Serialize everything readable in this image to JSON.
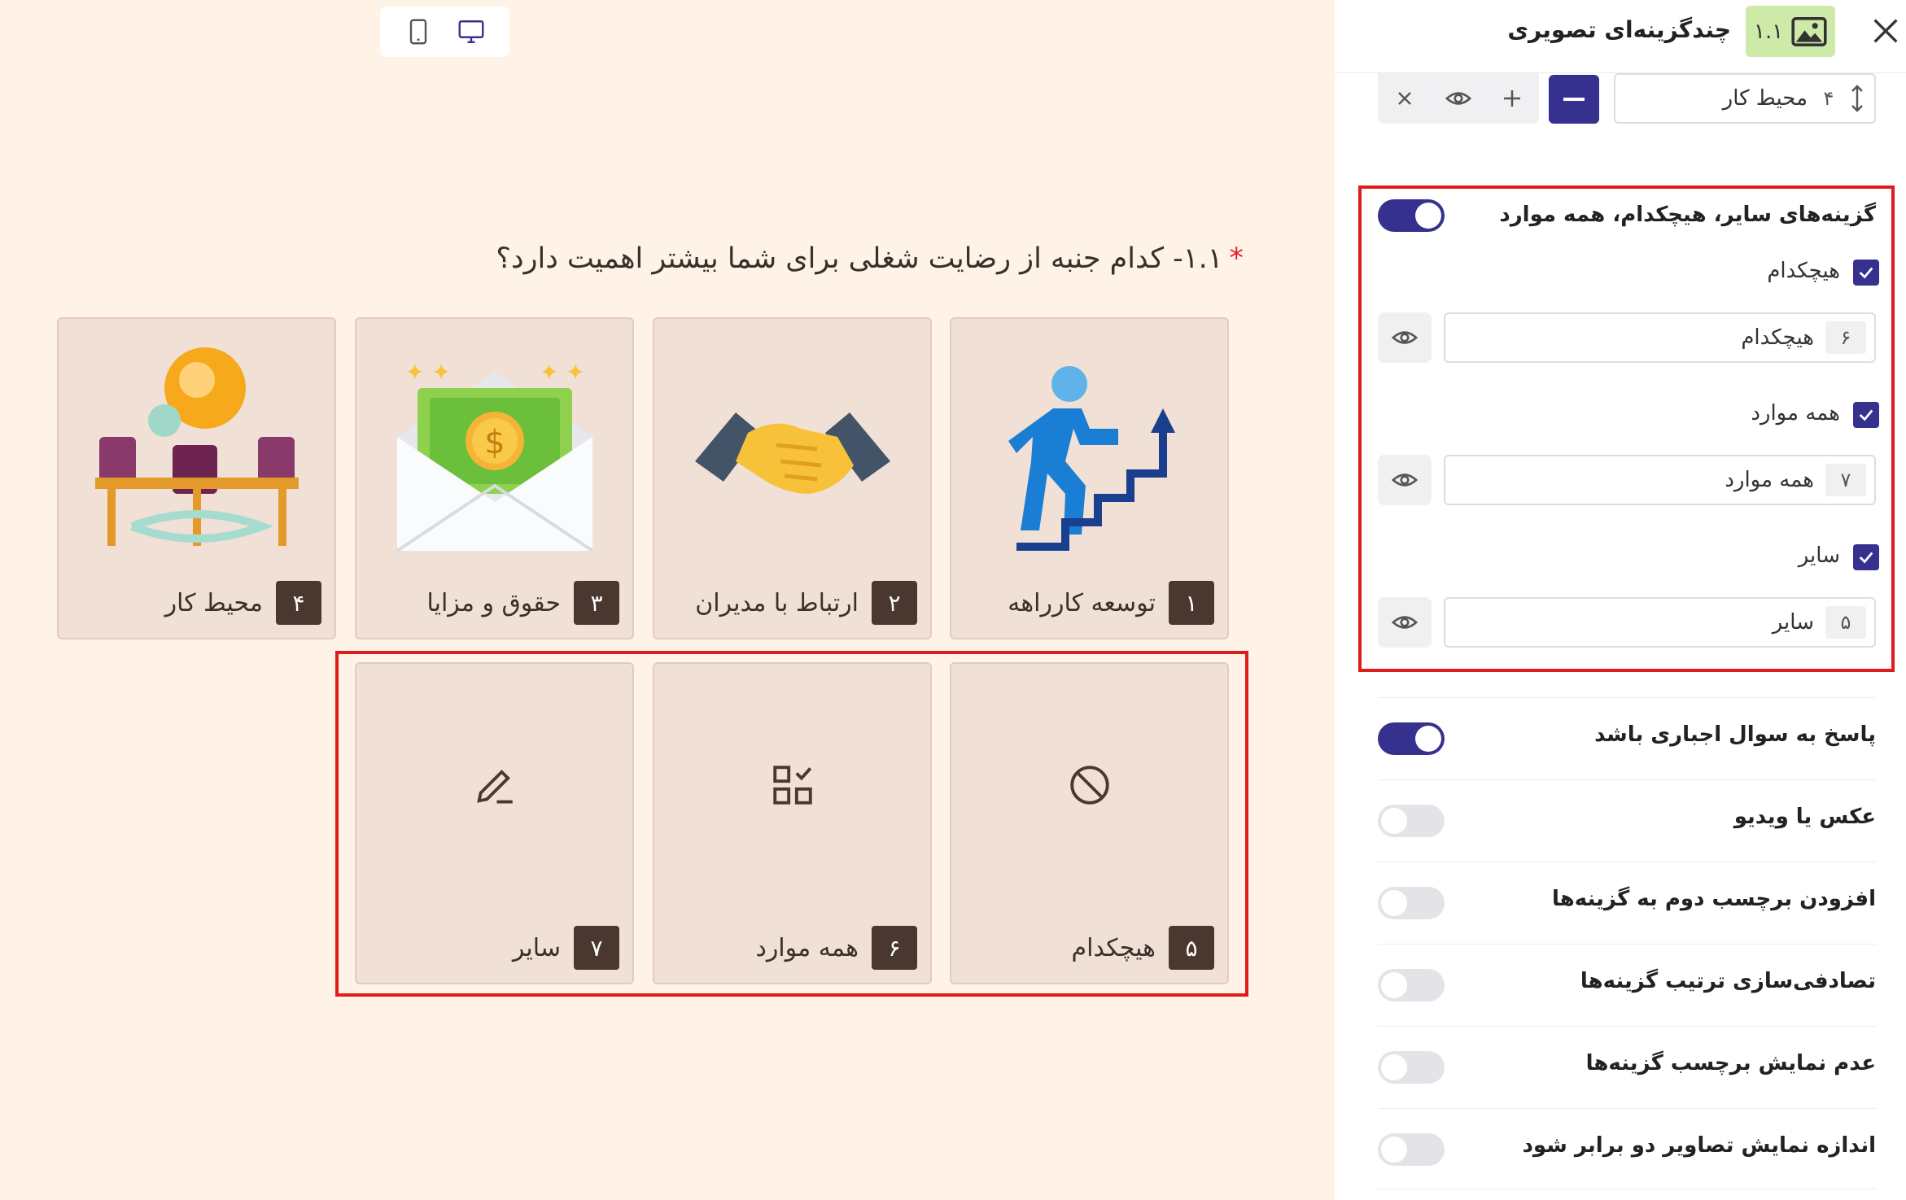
{
  "device_toggle": {
    "mobile_icon": "mobile-icon",
    "desktop_icon": "desktop-icon"
  },
  "question": {
    "required_mark": "*",
    "text": "۱.۱- کدام جنبه از رضایت شغلی برای شما بیشتر اهمیت دارد؟"
  },
  "options": [
    {
      "num": "۱",
      "label": "توسعه کارراهه",
      "icon": "career-stairs-illustration"
    },
    {
      "num": "۲",
      "label": "ارتباط با مدیران",
      "icon": "handshake-illustration"
    },
    {
      "num": "۳",
      "label": "حقوق و مزایا",
      "icon": "money-envelope-illustration"
    },
    {
      "num": "۴",
      "label": "محیط کار",
      "icon": "workplace-illustration"
    }
  ],
  "special_options": [
    {
      "num": "۵",
      "label": "هیچکدام",
      "icon": "ban-icon"
    },
    {
      "num": "۶",
      "label": "همه موارد",
      "icon": "checklist-icon"
    },
    {
      "num": "۷",
      "label": "سایر",
      "icon": "pencil-icon"
    }
  ],
  "panel": {
    "badge_number": "۱.۱",
    "badge_icon": "image-icon",
    "title": "چندگزینه‌ای تصویری",
    "option4": {
      "order": "۴",
      "value": "محیط کار"
    },
    "special_section": {
      "title": "گزینه‌های سایر، هیچکدام، همه موارد",
      "enabled": true,
      "items": [
        {
          "check_label": "هیچکدام",
          "order": "۶",
          "value": "هیچکدام"
        },
        {
          "check_label": "همه موارد",
          "order": "۷",
          "value": "همه موارد"
        },
        {
          "check_label": "سایر",
          "order": "۵",
          "value": "سایر"
        }
      ]
    },
    "settings": [
      {
        "title": "پاسخ به سوال اجباری باشد",
        "on": true
      },
      {
        "title": "عکس یا ویدیو",
        "on": false
      },
      {
        "title": "افزودن برچسب دوم به گزینه‌ها",
        "on": false
      },
      {
        "title": "تصادفی‌سازی ترتیب گزینه‌ها",
        "on": false
      },
      {
        "title": "عدم نمایش برچسب گزینه‌ها",
        "on": false
      },
      {
        "title": "اندازه نمایش تصاویر دو برابر شود",
        "on": false
      }
    ]
  },
  "colors": {
    "accent": "#36318f",
    "highlight": "#e01b1b",
    "card_bg": "#f0e0d5",
    "canvas_bg": "#fff3e8",
    "badge_bg": "#cdeaa8"
  }
}
